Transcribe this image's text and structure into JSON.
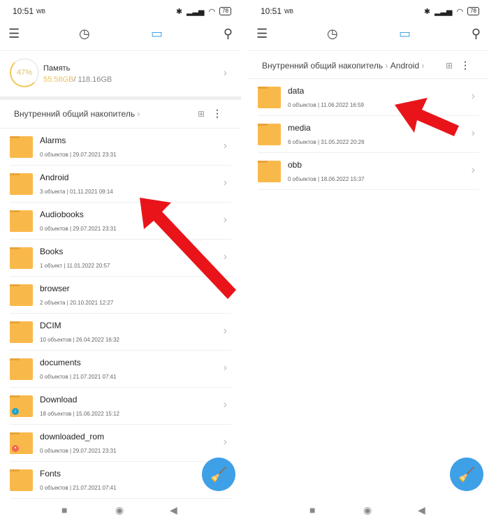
{
  "status": {
    "time": "10:51",
    "carrier": "WB",
    "battery": "78"
  },
  "left": {
    "storage": {
      "percent": "47%",
      "title": "Память",
      "used": "55.58GB",
      "total": "/ 118.16GB",
      "fill": 0.47
    },
    "breadcrumb": [
      "Внутренний общий накопитель"
    ],
    "folders": [
      {
        "name": "Alarms",
        "meta": "0 объектов  |  29.07.2021 23:31"
      },
      {
        "name": "Android",
        "meta": "3 объекта  |  01.11.2021 09:14"
      },
      {
        "name": "Audiobooks",
        "meta": "0 объектов  |  29.07.2021 23:31"
      },
      {
        "name": "Books",
        "meta": "1 объект  |  11.01.2022 20:57"
      },
      {
        "name": "browser",
        "meta": "2 объекта  |  20.10.2021 12:27"
      },
      {
        "name": "DCIM",
        "meta": "10 объектов  |  26.04.2022 16:32"
      },
      {
        "name": "documents",
        "meta": "0 объектов  |  21.07.2021 07:41"
      },
      {
        "name": "Download",
        "meta": "18 объектов  |  15.06.2022 15:12",
        "badge": "download-icon",
        "badge_color": "#1fa3c9"
      },
      {
        "name": "downloaded_rom",
        "meta": "0 объектов  |  29.07.2021 23:31",
        "badge": "rom-icon",
        "badge_color": "#f06a50"
      },
      {
        "name": "Fonts",
        "meta": "0 объектов  |  21.07.2021 07:41"
      }
    ]
  },
  "right": {
    "breadcrumb": [
      "Внутренний общий накопитель",
      "Android"
    ],
    "folders": [
      {
        "name": "data",
        "meta": "0 объектов  |  11.06.2022 16:59"
      },
      {
        "name": "media",
        "meta": "6 объектов  |  31.05.2022 20:26"
      },
      {
        "name": "obb",
        "meta": "0 объектов  |  18.06.2022 15:37"
      }
    ]
  },
  "colors": {
    "accent": "#3ea0e6",
    "folder": "#f9b94a",
    "arrow": "#e8141a"
  }
}
